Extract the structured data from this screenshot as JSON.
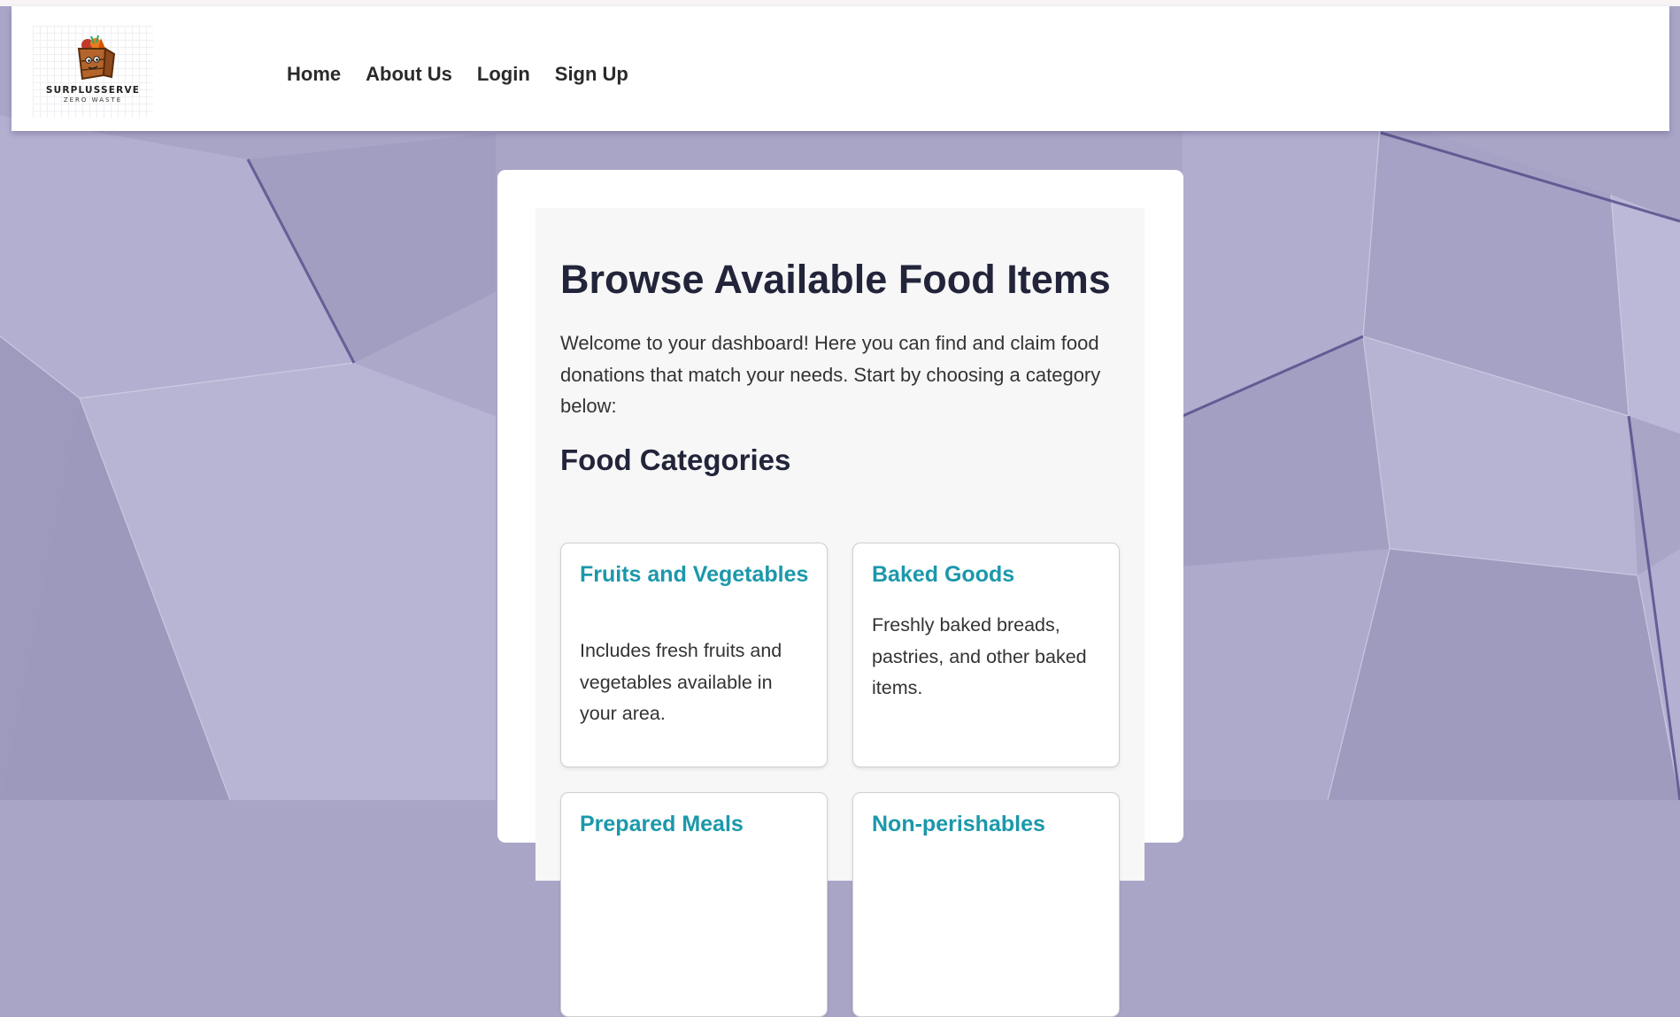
{
  "brand": {
    "name": "SURPLUSSERVE",
    "tagline": "ZERO WASTE"
  },
  "nav": {
    "items": [
      {
        "label": "Home"
      },
      {
        "label": "About Us"
      },
      {
        "label": "Login"
      },
      {
        "label": "Sign Up"
      }
    ]
  },
  "main": {
    "title": "Browse Available Food Items",
    "intro": "Welcome to your dashboard! Here you can find and claim food donations that match your needs. Start by choosing a category below:",
    "categories_title": "Food Categories",
    "categories": [
      {
        "title": "Fruits and Vegetables",
        "description": "Includes fresh fruits and vegetables available in your area."
      },
      {
        "title": "Baked Goods",
        "description": "Freshly baked breads, pastries, and other baked items."
      },
      {
        "title": "Prepared Meals",
        "description": ""
      },
      {
        "title": "Non-perishables",
        "description": ""
      }
    ]
  },
  "colors": {
    "background": "#a9a5c7",
    "card_title": "#1b98ab",
    "heading": "#22253a",
    "panel": "#ffffff",
    "inner_panel": "#f7f7f8"
  },
  "icons": {
    "logo": "food-crate-icon"
  }
}
